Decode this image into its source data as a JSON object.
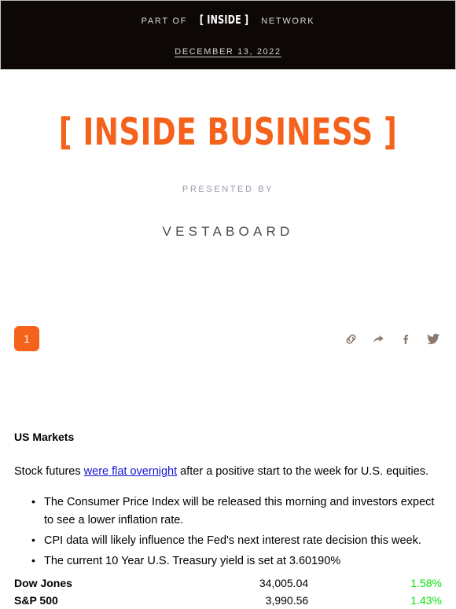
{
  "network_bar": {
    "prefix": "PART OF",
    "brand": "[ INSIDE ]",
    "suffix": "NETWORK",
    "date": "DECEMBER 13, 2022"
  },
  "masthead": {
    "title": "[ INSIDE BUSINESS ]",
    "presented_by_label": "PRESENTED BY",
    "sponsor": "VESTABOARD",
    "brand_color": "#f4621c"
  },
  "action_row": {
    "badge_count": "1",
    "share_icons": [
      {
        "name": "link-icon",
        "title": "Copy link"
      },
      {
        "name": "share-arrow-icon",
        "title": "Share"
      },
      {
        "name": "facebook-icon",
        "title": "Share on Facebook"
      },
      {
        "name": "twitter-icon",
        "title": "Share on Twitter"
      }
    ]
  },
  "article": {
    "heading": "US Markets",
    "lede_before": "Stock futures ",
    "lede_link": "were flat overnight",
    "lede_after": " after a positive start to the week for U.S. equities.",
    "bullets": [
      "The Consumer Price Index will be released this morning and investors expect to see a lower inflation rate.",
      "CPI data will likely influence the Fed's next interest rate decision this week.",
      "The current 10 Year U.S. Treasury yield is set at 3.60190%"
    ]
  },
  "market_table": {
    "positive_color": "#0ae40a",
    "rows": [
      {
        "name": "Dow Jones",
        "value": "34,005.04",
        "change": "1.58%"
      },
      {
        "name": "S&P 500",
        "value": "3,990.56",
        "change": "1.43%"
      }
    ]
  }
}
